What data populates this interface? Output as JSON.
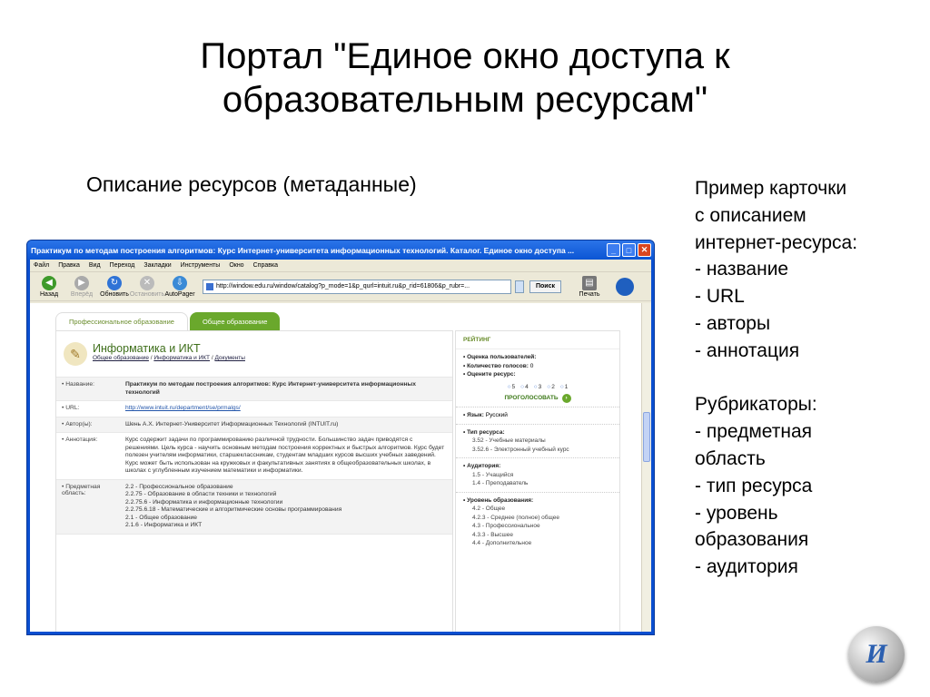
{
  "slide": {
    "title_line1": "Портал \"Единое окно доступа к",
    "title_line2": "образовательным ресурсам\"",
    "subtitle": "Описание ресурсов (метаданные)",
    "side_lines": [
      "Пример карточки",
      "с описанием",
      "интернет-ресурса:",
      "- название",
      "- URL",
      "- авторы",
      "- аннотация",
      "",
      "Рубрикаторы:",
      "- предметная",
      "область",
      "- тип ресурса",
      "- уровень",
      "образования",
      "- аудитория"
    ]
  },
  "browser": {
    "title": "Практикум по методам построения алгоритмов: Курс Интернет-университета информационных технологий. Каталог. Единое окно доступа ...",
    "menu": [
      "Файл",
      "Правка",
      "Вид",
      "Переход",
      "Закладки",
      "Инструменты",
      "Окно",
      "Справка"
    ],
    "toolbar": {
      "back": "Назад",
      "forward": "Вперёд",
      "refresh": "Обновить",
      "stop": "Остановить",
      "autopager": "AutoPager",
      "print": "Печать",
      "search": "Поиск"
    },
    "address": "http://window.edu.ru/window/catalog?p_mode=1&p_qurl=intuit.ru&p_rid=61806&p_rubr=..."
  },
  "page": {
    "tabs": [
      "Профессиональное образование",
      "Общее образование"
    ],
    "rubric_title": "Информатика и ИКТ",
    "breadcrumb": [
      "Общее образование",
      "Информатика и ИКТ",
      "Документы"
    ],
    "meta": {
      "name_label": "• Название:",
      "name_value": "Практикум по методам построения алгоритмов: Курс Интернет-университета информационных технологий",
      "url_label": "• URL:",
      "url_value": "http://www.intuit.ru/department/se/prmalgs/",
      "author_label": "• Автор(ы):",
      "author_value": "Шень А.Х. Интернет-Университет Информационных Технологий (INTUIT.ru)",
      "annot_label": "• Аннотация:",
      "annot_value": "Курс содержит задачи по программированию различной трудности. Большинство задач приводятся с решениями. Цель курса - научить основным методам построения корректных и быстрых алгоритмов. Курс будет полезен учителям информатики, старшеклассникам, студентам младших курсов высших учебных заведений. Курс может быть использован на кружковых и факультативных занятиях в общеобразовательных школах, в школах с углубленным изучением математики и информатики.",
      "subject_label": "• Предметная область:",
      "subject_values": [
        "2.2 - Профессиональное образование",
        "2.2.75 - Образование в области техники и технологий",
        "2.2.75.6 - Информатика и информационные технологии",
        "2.2.75.6.18 - Математические и алгоритмические основы программирования",
        "2.1 - Общее образование",
        "2.1.6 - Информатика и ИКТ"
      ]
    },
    "rating": {
      "header": "РЕЙТИНГ",
      "user_rating": "• Оценка пользователей:",
      "votes_label": "• Количество голосов:",
      "votes_value": "0",
      "rate_label": "• Оцените ресурс:",
      "options": [
        "5",
        "4",
        "3",
        "2",
        "1"
      ],
      "vote_button": "ПРОГОЛОСОВАТЬ",
      "language_label": "• Язык:",
      "language_value": "Русский",
      "type_label": "• Тип ресурса:",
      "type_values": [
        "3.52 - Учебные материалы",
        "3.52.6 - Электронный учебный курс"
      ],
      "audience_label": "• Аудитория:",
      "audience_values": [
        "1.5 - Учащийся",
        "1.4 - Преподаватель"
      ],
      "level_label": "• Уровень образования:",
      "level_values": [
        "4.2 - Общее",
        "4.2.3 - Среднее (полное) общее",
        "4.3 - Профессиональное",
        "4.3.3 - Высшее",
        "4.4 - Дополнительное"
      ]
    }
  }
}
